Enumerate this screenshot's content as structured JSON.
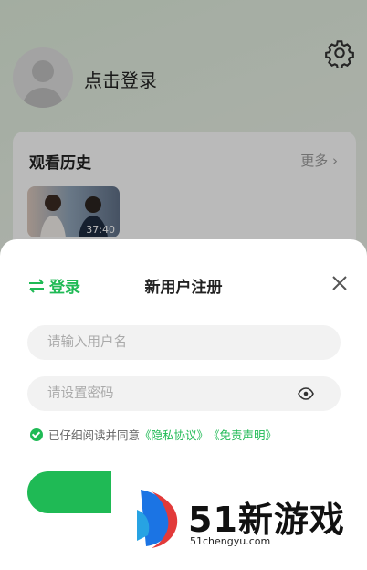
{
  "profile": {
    "login_prompt": "点击登录"
  },
  "history": {
    "title": "观看历史",
    "more_label": "更多",
    "items": [
      {
        "duration": "37:40"
      }
    ]
  },
  "sheet": {
    "switch_login": "登录",
    "title": "新用户注册",
    "username_placeholder": "请输入用户名",
    "password_placeholder": "请设置密码",
    "agreement": {
      "prefix": "已仔细阅读并同意",
      "privacy_link": "《隐私协议》",
      "disclaimer_link": "《免责声明》"
    }
  },
  "watermark": {
    "brand": "51新游戏",
    "domain": "51chengyu.com"
  },
  "colors": {
    "accent": "#1fba55"
  }
}
